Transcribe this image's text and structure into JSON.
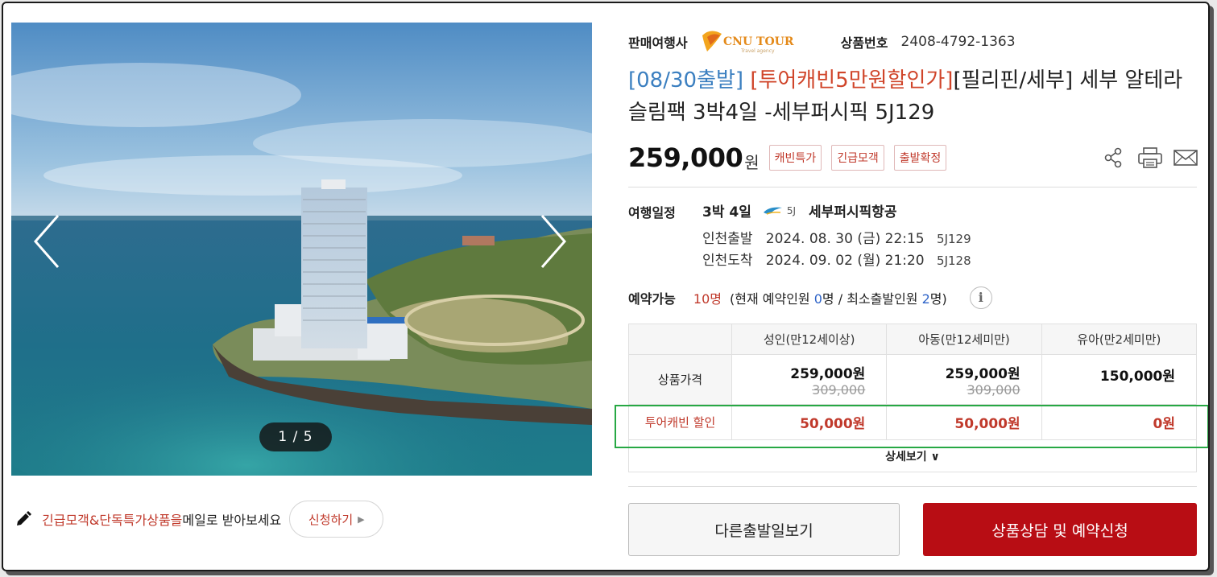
{
  "gallery": {
    "counter": "1 / 5"
  },
  "notify": {
    "highlight": "긴급모객&단독특가상품을",
    "rest": " 메일로 받아보세요",
    "apply_label": "신청하기",
    "apply_arrow": "▶"
  },
  "seller": {
    "label": "판매여행사",
    "logo_text": "CNU TOUR",
    "logo_sub": "Travel agency",
    "product_no_label": "상품번호",
    "product_no": "2408-4792-1363"
  },
  "title": {
    "part1": "[08/30출발]",
    "part2": "[투어캐빈5만원할인가]",
    "part3": "[필리핀/세부] 세부 알테라 슬림팩 3박4일 -세부퍼시픽 5J129"
  },
  "price": {
    "amount": "259,000",
    "unit": "원",
    "badges": [
      "캐빈특가",
      "긴급모객",
      "출발확정"
    ]
  },
  "itinerary": {
    "label": "여행일정",
    "duration": "3박 4일",
    "airline_code": "5J",
    "airline": "세부퍼시픽항공",
    "depart": {
      "label": "인천출발",
      "datetime": "2024. 08. 30 (금) 22:15",
      "flight": "5J129"
    },
    "arrive": {
      "label": "인천도착",
      "datetime": "2024. 09. 02 (월) 21:20",
      "flight": "5J128"
    }
  },
  "availability": {
    "label": "예약가능",
    "count": "10명",
    "p1": "(현재 예약인원 ",
    "current": "0",
    "p2": "명 / 최소출발인원 ",
    "min": "2",
    "p3": "명)",
    "info": "i"
  },
  "fare_table": {
    "headers": [
      "성인(만12세이상)",
      "아동(만12세미만)",
      "유아(만2세미만)"
    ],
    "price_row": {
      "label": "상품가격",
      "values": [
        "259,000원",
        "259,000원",
        "150,000원"
      ],
      "originals": [
        "309,000",
        "309,000",
        ""
      ]
    },
    "discount_row": {
      "label": "투어캐빈 할인",
      "values": [
        "50,000원",
        "50,000원",
        "0원"
      ]
    },
    "detail_label": "상세보기 ∨"
  },
  "buttons": {
    "other_dates": "다른출발일보기",
    "book": "상품상담 및 예약신청"
  },
  "colors": {
    "accent_red": "#b80d14",
    "highlight_green": "#27a844",
    "title_blue": "#3b7fc0"
  },
  "icons": [
    "share-icon",
    "print-icon",
    "mail-icon",
    "pencil-icon",
    "chevron-left-icon",
    "chevron-right-icon",
    "airline-logo-icon"
  ]
}
